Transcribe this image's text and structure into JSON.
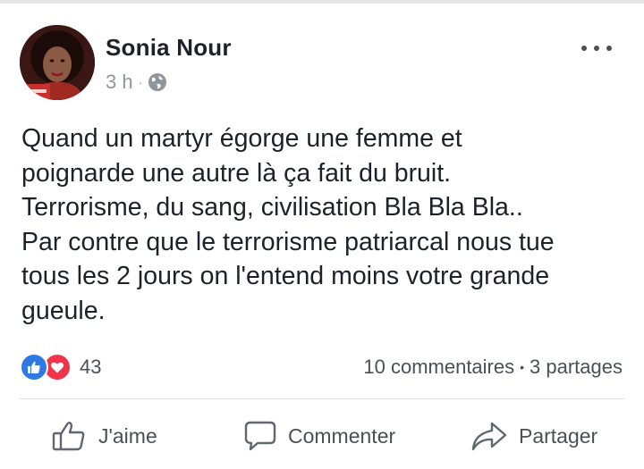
{
  "post": {
    "author_name": "Sonia Nour",
    "timestamp": "3 h",
    "separator": "·",
    "privacy_icon": "globe-icon",
    "menu_icon": "more-horizontal-icon",
    "text_lines": [
      "Quand un martyr égorge une femme et",
      "poignarde une autre là ça fait du bruit.",
      "Terrorisme, du sang, civilisation Bla Bla Bla..",
      "Par contre que le terrorisme patriarcal nous tue",
      "tous les 2 jours on l'entend moins votre grande",
      "gueule."
    ]
  },
  "reactions": {
    "icons": [
      "like-reaction-icon",
      "love-reaction-icon"
    ],
    "count": "43"
  },
  "stats": {
    "comments": "10 commentaires",
    "separator": "•",
    "shares": "3 partages"
  },
  "actions": {
    "like_label": "J'aime",
    "comment_label": "Commenter",
    "share_label": "Partager"
  },
  "colors": {
    "like_blue": "#2f79e5",
    "love_red": "#f0354a",
    "secondary_text": "#90949c",
    "action_text": "#4b4f56"
  }
}
